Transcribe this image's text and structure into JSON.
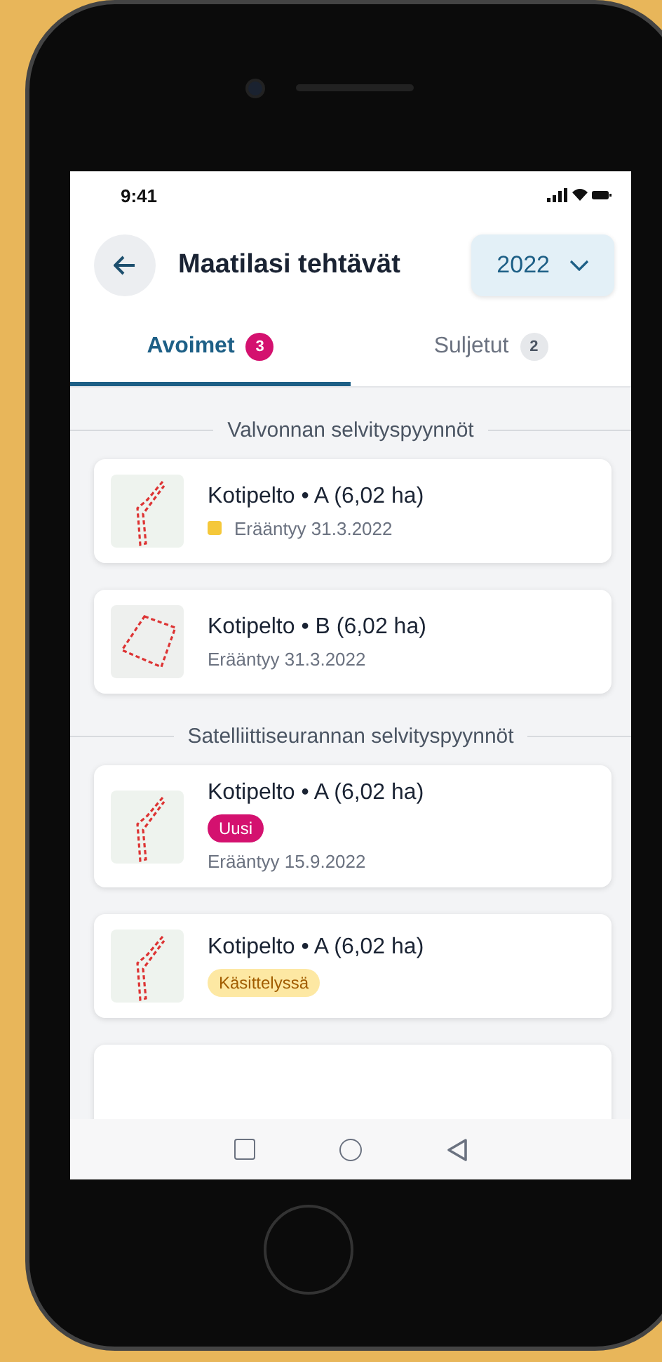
{
  "status_bar": {
    "time": "9:41"
  },
  "header": {
    "title": "Maatilasi tehtävät",
    "year": "2022"
  },
  "tabs": [
    {
      "label": "Avoimet",
      "count": "3",
      "selected": true
    },
    {
      "label": "Suljetut",
      "count": "2",
      "selected": false
    }
  ],
  "sections": [
    {
      "title": "Valvonnan selvityspyynnöt",
      "items": [
        {
          "title": "Kotipelto • A (6,02 ha)",
          "kind": "strip",
          "due": "Erääntyy 31.3.2022",
          "color": "#f5c83a"
        },
        {
          "title": "Kotipelto • B (6,02 ha)",
          "kind": "quad",
          "due": "Erääntyy 31.3.2022"
        }
      ]
    },
    {
      "title": "Satelliittiseurannan selvityspyynnöt",
      "items": [
        {
          "title": "Kotipelto • A (6,02 ha)",
          "kind": "strip",
          "tag": {
            "label": "Uusi",
            "kind": "new"
          },
          "due": "Erääntyy 15.9.2022"
        },
        {
          "title": "Kotipelto • A (6,02 ha)",
          "kind": "strip",
          "tag": {
            "label": "Käsittelyssä",
            "kind": "processing"
          }
        }
      ]
    }
  ]
}
